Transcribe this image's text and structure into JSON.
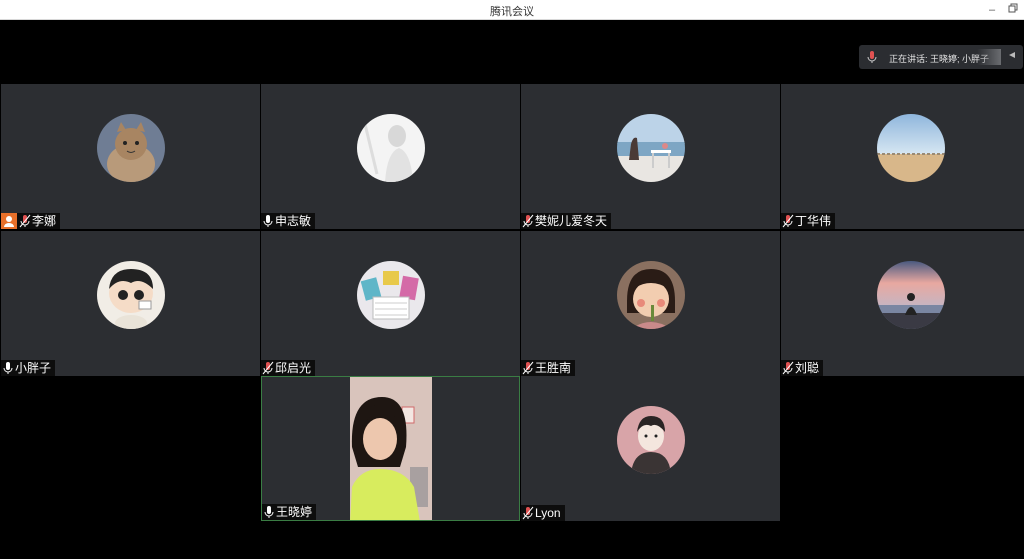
{
  "window": {
    "title": "腾讯会议"
  },
  "speaking_banner": {
    "text": "正在讲话: 王晓婷; 小胖子;..."
  },
  "participants": [
    {
      "name": "李娜",
      "mic": "muted",
      "host": true
    },
    {
      "name": "申志敏",
      "mic": "on",
      "host": false
    },
    {
      "name": "樊妮儿爱冬天",
      "mic": "muted",
      "host": false
    },
    {
      "name": "丁华伟",
      "mic": "muted",
      "host": false
    },
    {
      "name": "小胖子",
      "mic": "on",
      "host": false
    },
    {
      "name": "邱启光",
      "mic": "muted",
      "host": false
    },
    {
      "name": "王胜南",
      "mic": "muted",
      "host": false
    },
    {
      "name": "刘聪",
      "mic": "muted",
      "host": false
    },
    {
      "name": "王晓婷",
      "mic": "on",
      "host": false,
      "video": true,
      "active": true
    },
    {
      "name": "Lyon",
      "mic": "muted",
      "host": false
    }
  ],
  "colors": {
    "tile_bg": "#2c2e32",
    "active_border": "#3a7d44",
    "muted_mic": "#e05252",
    "host_badge": "#e8702a"
  }
}
